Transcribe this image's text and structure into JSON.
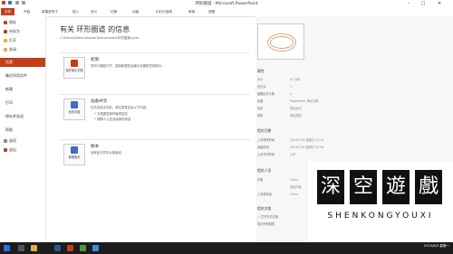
{
  "window": {
    "title": "环形圈道 - Microsoft PowerPoint",
    "help": "?",
    "minimize": "–",
    "maximize": "□",
    "close": "✕"
  },
  "ribbon": {
    "tabs": [
      "文件",
      "开始",
      "新建选项卡",
      "插入",
      "设计",
      "切换",
      "动画",
      "幻灯片放映",
      "审阅",
      "视图"
    ]
  },
  "sidebar": {
    "items": [
      {
        "label": "保存",
        "icon": "save-icon"
      },
      {
        "label": "另存为",
        "icon": "save-as-icon"
      },
      {
        "label": "打开",
        "icon": "open-icon"
      },
      {
        "label": "关闭",
        "icon": "close-file-icon"
      },
      {
        "label": "信息",
        "icon": ""
      },
      {
        "label": "最近所用文件",
        "icon": ""
      },
      {
        "label": "新建",
        "icon": ""
      },
      {
        "label": "打印",
        "icon": ""
      },
      {
        "label": "保存并发送",
        "icon": ""
      },
      {
        "label": "帮助",
        "icon": ""
      },
      {
        "label": "选项",
        "icon": "options-icon"
      },
      {
        "label": "退出",
        "icon": "exit-icon"
      }
    ],
    "active": "信息"
  },
  "info": {
    "title": "有关 环形圈道 的信息",
    "path": "C:\\Users\\Administrator\\Documents\\环形圈道.pptx",
    "permissions": {
      "button": "保护演示文稿",
      "title": "权限",
      "desc": "任何人都能打开、复制和更改此演示文稿的任何部分。"
    },
    "prepare": {
      "button": "检查问题",
      "title": "准备共享",
      "desc": "在共享此文件前，请注意其包含以下内容：",
      "bullets": [
        "文档属性和作者的姓名",
        "残障人士无法阅读的内容"
      ]
    },
    "versions": {
      "button": "管理版本",
      "title": "版本",
      "desc": "没有此文件的以前版本。"
    }
  },
  "properties": {
    "header": "属性",
    "rows": [
      {
        "k": "大小",
        "v": "47.1KB"
      },
      {
        "k": "幻灯片",
        "v": "1"
      },
      {
        "k": "隐藏幻灯片数",
        "v": "0"
      },
      {
        "k": "标题",
        "v": "PowerPoint 演示文稿"
      },
      {
        "k": "标记",
        "v": "添加标记"
      },
      {
        "k": "类别",
        "v": "添加类别"
      }
    ],
    "dates_header": "相关日期",
    "dates": [
      {
        "k": "上次修改时间",
        "v": "2019/7/28 星期日 21:10"
      },
      {
        "k": "创建时间",
        "v": "2019/7/28 星期日 20:36"
      },
      {
        "k": "上次打印时间",
        "v": "从不"
      }
    ],
    "people_header": "相关人员",
    "people": [
      {
        "k": "作者",
        "v": "China"
      },
      {
        "k": "",
        "v": "添加作者"
      },
      {
        "k": "上次修改者",
        "v": "China"
      }
    ],
    "docs_header": "相关文档",
    "open_location": "打开文件位置",
    "show_all": "显示所有属性"
  },
  "watermark": {
    "chars": [
      "深",
      "空",
      "遊",
      "戲"
    ],
    "text": "SHENKONGYOUXI"
  },
  "taskbar": {
    "time": "2019/8/5 星期一"
  },
  "colors": {
    "accent": "#c43e1c"
  }
}
